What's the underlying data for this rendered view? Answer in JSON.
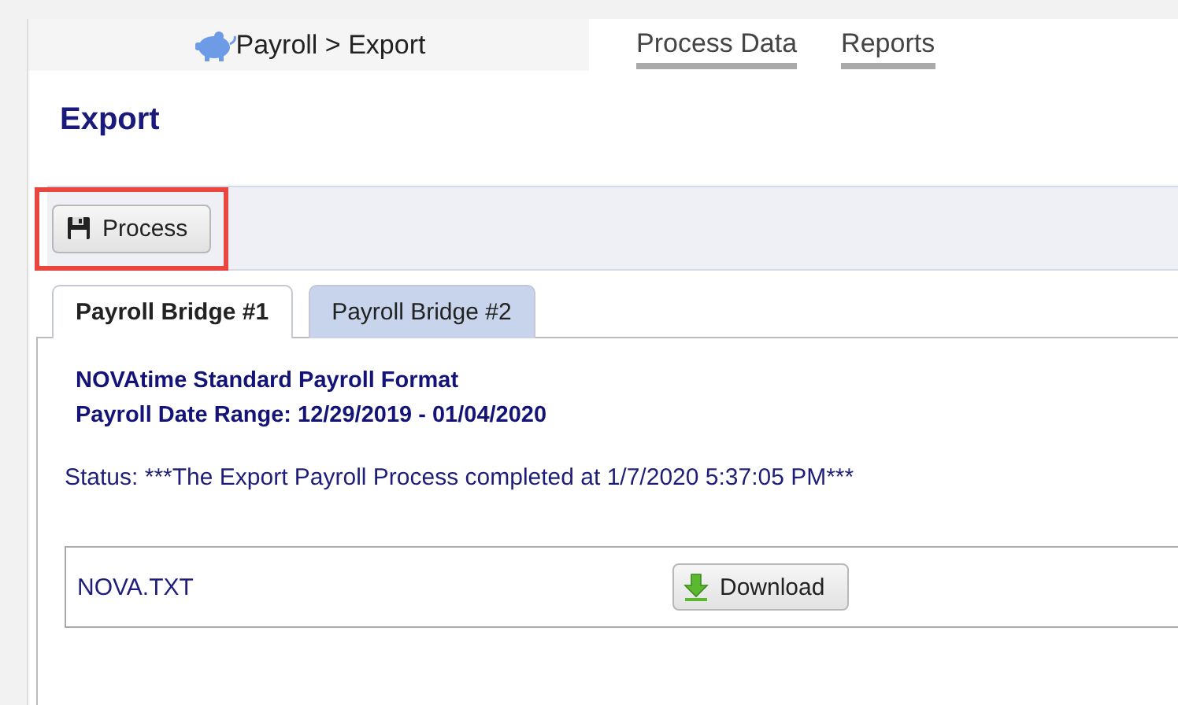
{
  "breadcrumb": "Payroll > Export",
  "nav_links": [
    {
      "label": "Process Data"
    },
    {
      "label": "Reports"
    }
  ],
  "page_title": "Export",
  "toolbar": {
    "button": {
      "label": "Process",
      "highlighted": true
    }
  },
  "tabs": [
    {
      "label": "Payroll Bridge #1",
      "selected": true
    },
    {
      "label": "Payroll Bridge #2",
      "selected": false
    }
  ],
  "format_lines": [
    "NOVAtime Standard Payroll Format",
    "Payroll Date Range: 12/29/2019 - 01/04/2020"
  ],
  "status": "Status: ***The Export Payroll Process completed at 1/7/2020 5:37:05 PM***",
  "files": [
    {
      "name": "NOVA.TXT",
      "button": "Download"
    }
  ]
}
